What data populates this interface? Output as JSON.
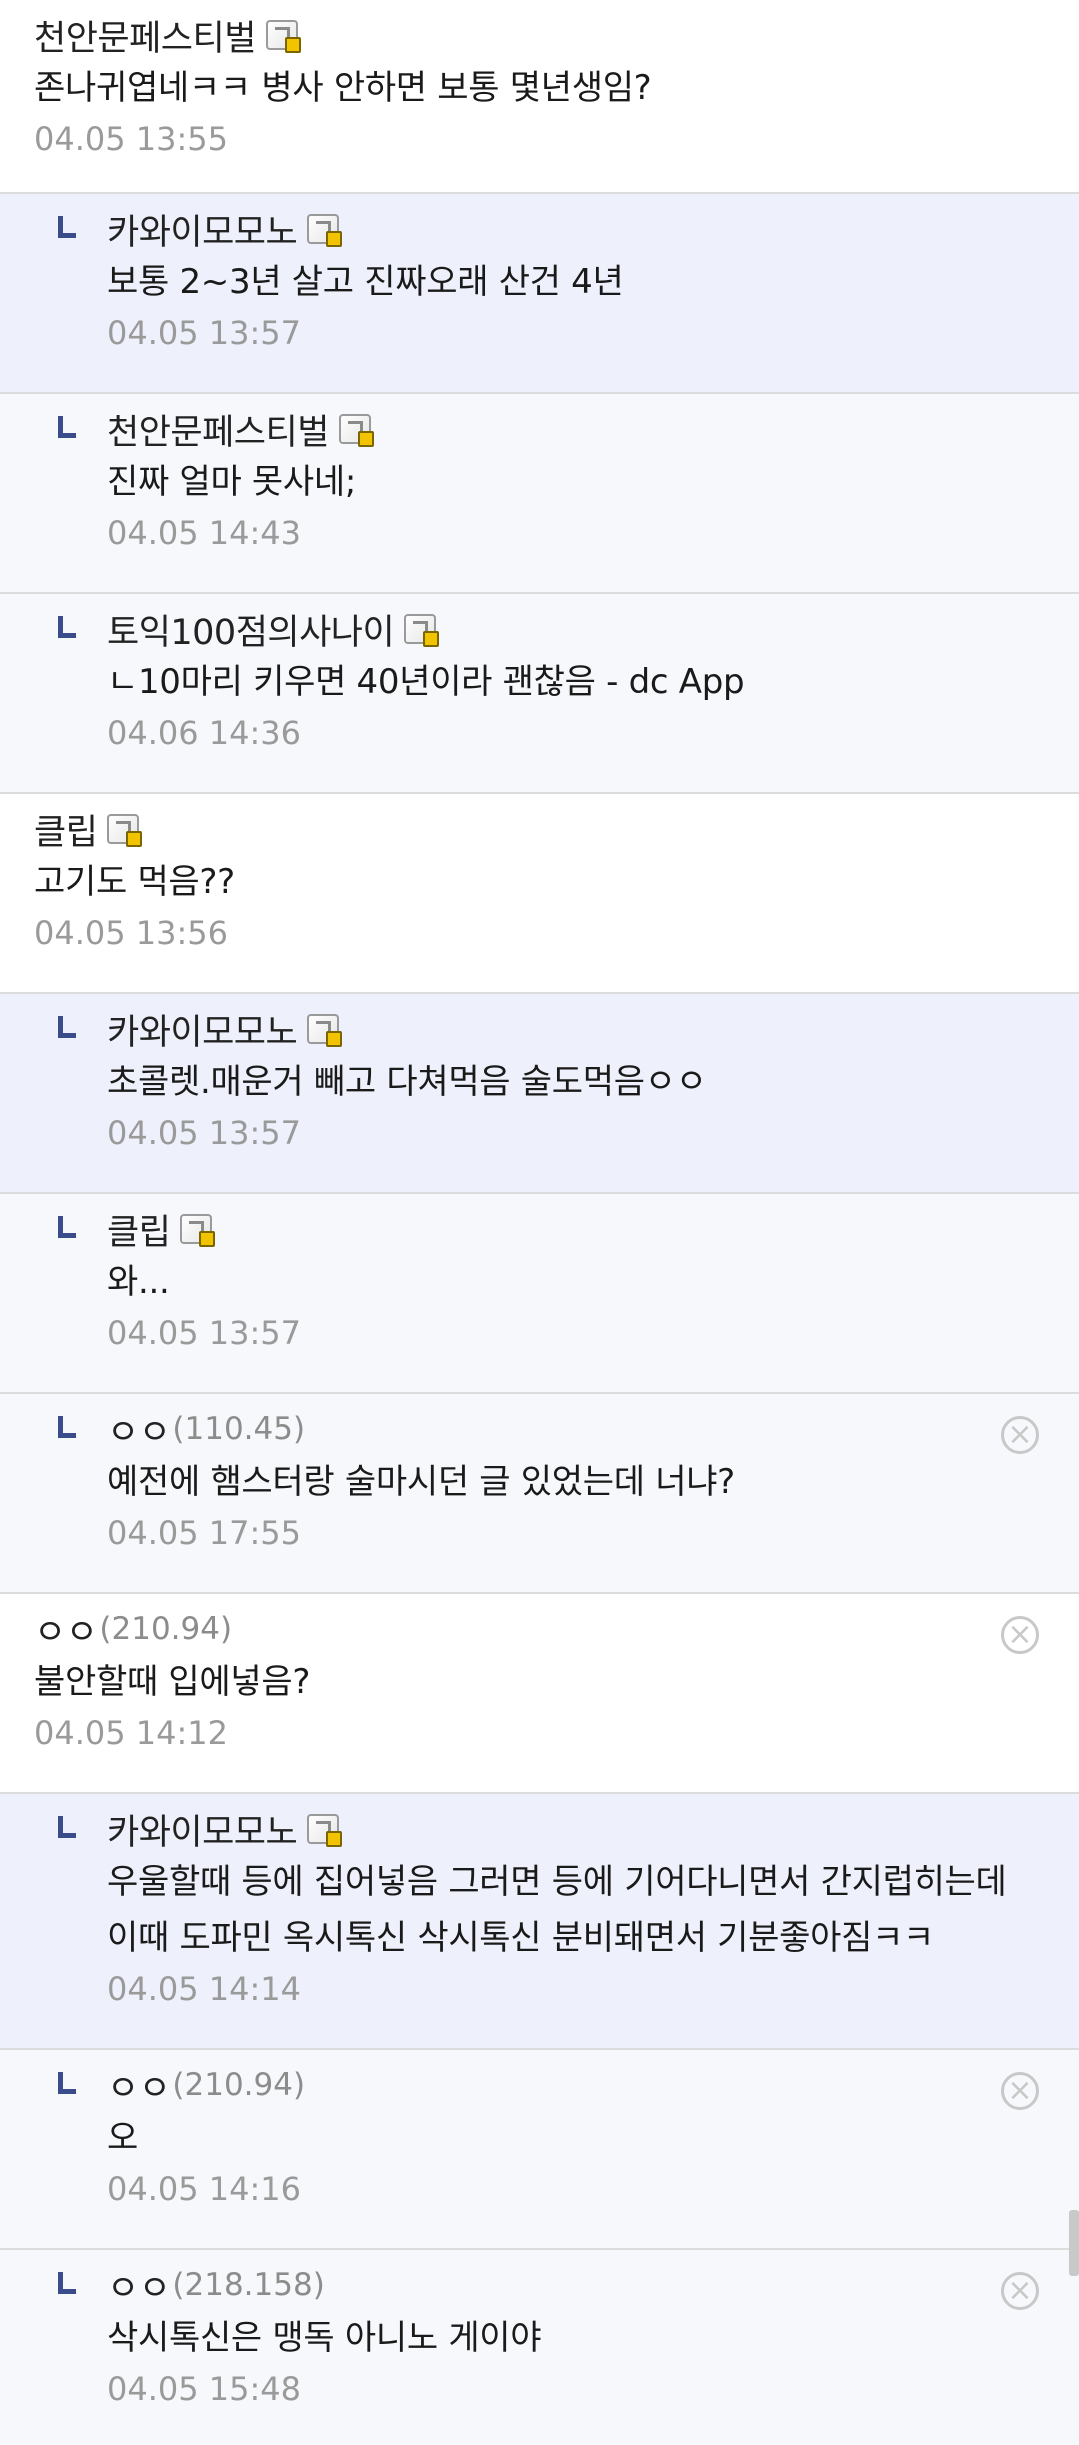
{
  "comments": [
    {
      "nick": "천안문페스티벌",
      "ip": "",
      "member": true,
      "text": "존나귀엽네ㅋㅋ 병사 안하면 보통 몇년생임?",
      "date": "04.05 13:55",
      "reply": false,
      "deletable": false
    },
    {
      "nick": "카와이모모노",
      "ip": "",
      "member": true,
      "text": "보통 2~3년 살고 진짜오래 산건 4년",
      "date": "04.05 13:57",
      "reply": true,
      "op": true,
      "deletable": false
    },
    {
      "nick": "천안문페스티벌",
      "ip": "",
      "member": true,
      "text": "진짜 얼마 못사네;",
      "date": "04.05 14:43",
      "reply": true,
      "op": false,
      "deletable": false
    },
    {
      "nick": "토익100점의사나이",
      "ip": "",
      "member": true,
      "text": "ㄴ10마리 키우면 40년이라 괜찮음 - dc App",
      "date": "04.06 14:36",
      "reply": true,
      "op": false,
      "deletable": false
    },
    {
      "nick": "클립",
      "ip": "",
      "member": true,
      "text": "고기도 먹음??",
      "date": "04.05 13:56",
      "reply": false,
      "deletable": false
    },
    {
      "nick": "카와이모모노",
      "ip": "",
      "member": true,
      "text": "초콜렛.매운거 빼고 다쳐먹음 술도먹음ㅇㅇ",
      "date": "04.05 13:57",
      "reply": true,
      "op": true,
      "deletable": false
    },
    {
      "nick": "클립",
      "ip": "",
      "member": true,
      "text": "와...",
      "date": "04.05 13:57",
      "reply": true,
      "op": false,
      "deletable": false
    },
    {
      "nick": "ㅇㅇ",
      "ip": "(110.45)",
      "member": false,
      "text": "예전에 햄스터랑 술마시던 글 있었는데 너냐?",
      "date": "04.05 17:55",
      "reply": true,
      "op": false,
      "deletable": true
    },
    {
      "nick": "ㅇㅇ",
      "ip": "(210.94)",
      "member": false,
      "text": "불안할때 입에넣음?",
      "date": "04.05 14:12",
      "reply": false,
      "deletable": true
    },
    {
      "nick": "카와이모모노",
      "ip": "",
      "member": true,
      "text": "우울할때 등에 집어넣음 그러면 등에 기어다니면서 간지럽히는데 이때 도파민 옥시톡신 삭시톡신 분비돼면서 기분좋아짐ㅋㅋ",
      "date": "04.05 14:14",
      "reply": true,
      "op": true,
      "deletable": false
    },
    {
      "nick": "ㅇㅇ",
      "ip": "(210.94)",
      "member": false,
      "text": "오",
      "date": "04.05 14:16",
      "reply": true,
      "op": false,
      "deletable": true
    },
    {
      "nick": "ㅇㅇ",
      "ip": "(218.158)",
      "member": false,
      "text": "삭시톡신은 맹독 아니노 게이야",
      "date": "04.05 15:48",
      "reply": true,
      "op": false,
      "deletable": true
    }
  ],
  "icons": {
    "reply": "reply-arrow-icon",
    "member": "gallog-icon",
    "delete": "delete-circle-icon"
  },
  "colors": {
    "op_reply_bg": "#eef1fb",
    "reply_bg": "#f7f8fb",
    "reply_mark": "#3b4c8a",
    "date": "#9a9a9a"
  }
}
